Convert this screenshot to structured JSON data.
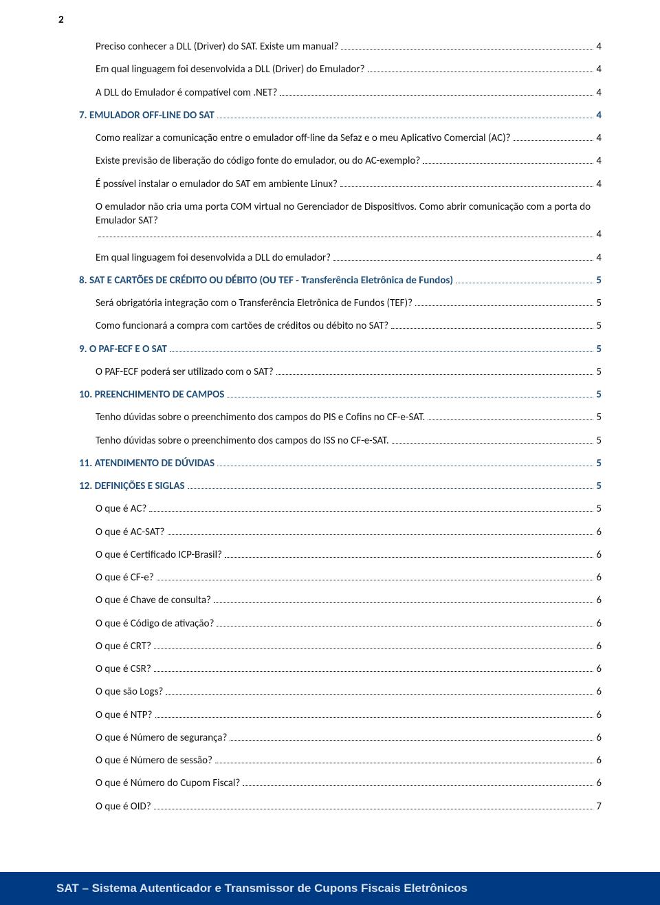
{
  "page_number": "2",
  "footer": "SAT – Sistema Autenticador e Transmissor de Cupons Fiscais Eletrônicos",
  "toc": [
    {
      "type": "entry",
      "indent": 1,
      "text": "Preciso conhecer a DLL (Driver) do SAT. Existe um manual?",
      "page": "4"
    },
    {
      "type": "entry",
      "indent": 1,
      "text": "Em qual linguagem foi desenvolvida a DLL (Driver) do Emulador?",
      "page": "4"
    },
    {
      "type": "entry",
      "indent": 1,
      "text": "A DLL do Emulador é compatível com .NET?",
      "page": "4"
    },
    {
      "type": "section",
      "indent": 0,
      "text": "7.    EMULADOR OFF-LINE DO SAT",
      "page": "4"
    },
    {
      "type": "entry",
      "indent": 1,
      "text": "Como realizar a comunicação entre o emulador off-line da Sefaz e o meu Aplicativo Comercial (AC)?",
      "page": "4"
    },
    {
      "type": "entry",
      "indent": 1,
      "text": "Existe previsão de liberação do código fonte do emulador, ou do AC-exemplo?",
      "page": "4"
    },
    {
      "type": "entry",
      "indent": 1,
      "text": "É possível instalar o emulador do SAT em ambiente Linux?",
      "page": "4"
    },
    {
      "type": "entry",
      "indent": 1,
      "text": "O emulador não cria uma porta COM virtual no Gerenciador de Dispositivos.  Como abrir comunicação com a porta do Emulador SAT?",
      "page": "4",
      "wrap": true
    },
    {
      "type": "entry",
      "indent": 1,
      "text": "Em qual linguagem foi desenvolvida a DLL do emulador?",
      "page": "4"
    },
    {
      "type": "section",
      "indent": 0,
      "text": "8.    SAT E CARTÕES DE CRÉDITO OU DÉBITO (OU TEF - Transferência Eletrônica de Fundos)",
      "page": "5"
    },
    {
      "type": "entry",
      "indent": 1,
      "text": "Será obrigatória integração com o Transferência Eletrônica de Fundos (TEF)?",
      "page": "5"
    },
    {
      "type": "entry",
      "indent": 1,
      "text": "Como funcionará a compra com cartões de créditos ou débito no SAT?",
      "page": "5"
    },
    {
      "type": "section",
      "indent": 0,
      "text": "9.    O PAF-ECF E O SAT",
      "page": "5"
    },
    {
      "type": "entry",
      "indent": 1,
      "text": "O PAF-ECF poderá ser utilizado com o SAT?",
      "page": "5"
    },
    {
      "type": "section",
      "indent": 0,
      "text": "10.   PREENCHIMENTO DE CAMPOS",
      "page": "5"
    },
    {
      "type": "entry",
      "indent": 1,
      "text": "Tenho dúvidas sobre o preenchimento dos campos do PIS e Cofins no CF-e-SAT.",
      "page": "5"
    },
    {
      "type": "entry",
      "indent": 1,
      "text": "Tenho dúvidas sobre o preenchimento dos campos do ISS no CF-e-SAT.",
      "page": "5"
    },
    {
      "type": "section",
      "indent": 0,
      "text": "11.   ATENDIMENTO DE DÚVIDAS",
      "page": "5"
    },
    {
      "type": "section",
      "indent": 0,
      "text": "12.   DEFINIÇÕES E SIGLAS",
      "page": "5"
    },
    {
      "type": "entry",
      "indent": 1,
      "text": "O que é AC?",
      "page": "5"
    },
    {
      "type": "entry",
      "indent": 1,
      "text": "O que é AC-SAT?",
      "page": "6"
    },
    {
      "type": "entry",
      "indent": 1,
      "text": "O que é Certificado ICP-Brasil?",
      "page": "6"
    },
    {
      "type": "entry",
      "indent": 1,
      "text": "O que é CF-e?",
      "page": "6"
    },
    {
      "type": "entry",
      "indent": 1,
      "text": "O que é Chave de consulta?",
      "page": "6"
    },
    {
      "type": "entry",
      "indent": 1,
      "text": "O que é Código de ativação?",
      "page": "6"
    },
    {
      "type": "entry",
      "indent": 1,
      "text": "O que é CRT?",
      "page": "6"
    },
    {
      "type": "entry",
      "indent": 1,
      "text": "O que é CSR?",
      "page": "6"
    },
    {
      "type": "entry",
      "indent": 1,
      "text": "O que são Logs?",
      "page": "6"
    },
    {
      "type": "entry",
      "indent": 1,
      "text": "O que é NTP?",
      "page": "6"
    },
    {
      "type": "entry",
      "indent": 1,
      "text": "O que é Número de segurança?",
      "page": "6"
    },
    {
      "type": "entry",
      "indent": 1,
      "text": "O que é Número de sessão?",
      "page": "6"
    },
    {
      "type": "entry",
      "indent": 1,
      "text": "O que é Número do Cupom Fiscal?",
      "page": "6"
    },
    {
      "type": "entry",
      "indent": 1,
      "text": "O que é OID?",
      "page": "7"
    }
  ]
}
